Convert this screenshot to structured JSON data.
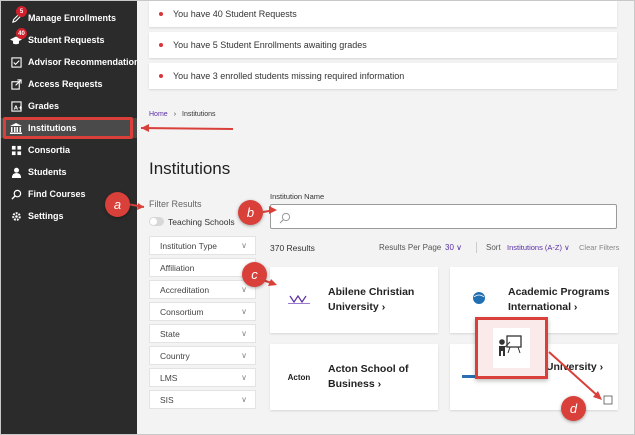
{
  "sidebar": {
    "items": [
      {
        "label": "Manage Enrollments",
        "icon": "pen-icon",
        "badge": "5"
      },
      {
        "label": "Student Requests",
        "icon": "graduation-cap-icon",
        "badge": "40"
      },
      {
        "label": "Advisor Recommendations",
        "icon": "checkbox-icon"
      },
      {
        "label": "Access Requests",
        "icon": "arrow-out-icon"
      },
      {
        "label": "Grades",
        "icon": "grade-icon"
      },
      {
        "label": "Institutions",
        "icon": "institution-icon",
        "active": true
      },
      {
        "label": "Consortia",
        "icon": "consortia-icon"
      },
      {
        "label": "Students",
        "icon": "person-icon"
      },
      {
        "label": "Find Courses",
        "icon": "search-icon"
      },
      {
        "label": "Settings",
        "icon": "gear-icon"
      }
    ]
  },
  "notices": [
    "You have 40 Student Requests",
    "You have 5 Student Enrollments awaiting grades",
    "You have 3 enrolled students missing required information"
  ],
  "breadcrumb": {
    "home": "Home",
    "sep": "›",
    "current": "Institutions"
  },
  "page_title": "Institutions",
  "filters": {
    "title": "Filter Results",
    "toggle_label": "Teaching Schools",
    "items": [
      "Institution Type",
      "Affiliation",
      "Accreditation",
      "Consortium",
      "State",
      "Country",
      "LMS",
      "SIS"
    ]
  },
  "search": {
    "label": "Institution Name",
    "value": "",
    "placeholder": ""
  },
  "results": {
    "count": "370 Results",
    "per_page_label": "Results Per Page",
    "per_page_value": "30 ∨",
    "sort_label": "Sort",
    "sort_value": "Institutions (A-Z) ∨",
    "clear_label": "Clear Filters"
  },
  "cards": [
    {
      "name": "Abilene Christian University ›",
      "logo": ""
    },
    {
      "name": "Academic Programs International ›",
      "logo": "api"
    },
    {
      "name": "Acton School of Business ›",
      "logo": "Acton"
    },
    {
      "name": "…ealth University ›",
      "logo": ""
    }
  ],
  "callouts": [
    "a",
    "b",
    "c",
    "d"
  ],
  "colors": {
    "accent": "#5a2ea6",
    "callout": "#d9403a",
    "sidebar": "#2b2b2b",
    "badge": "#d11f2b"
  }
}
